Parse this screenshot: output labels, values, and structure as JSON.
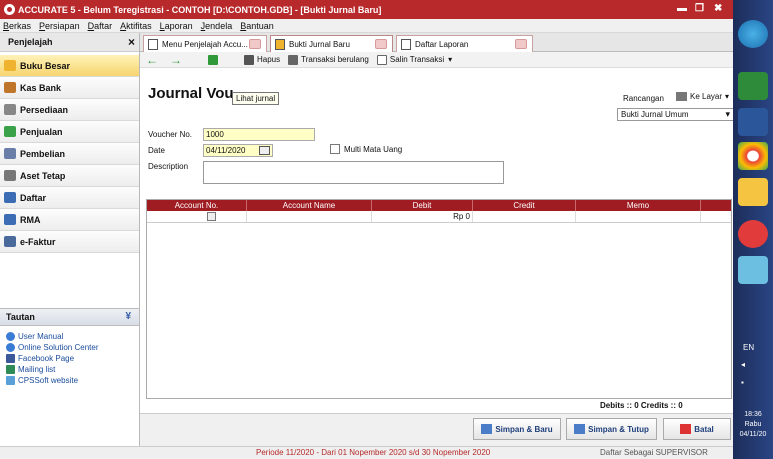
{
  "window": {
    "title": "ACCURATE 5 - Belum Teregistrasi - CONTOH  [D:\\CONTOH.GDB] - [Bukti Jurnal Baru]"
  },
  "menu": [
    "Berkas",
    "Persiapan",
    "Daftar",
    "Aktifitas",
    "Laporan",
    "Jendela",
    "Bantuan"
  ],
  "sidebar": {
    "header": "Penjelajah",
    "items": [
      {
        "label": "Buku Besar",
        "color": "#f0b330"
      },
      {
        "label": "Kas Bank",
        "color": "#c0762a"
      },
      {
        "label": "Persediaan",
        "color": "#888888"
      },
      {
        "label": "Penjualan",
        "color": "#3aa34a"
      },
      {
        "label": "Pembelian",
        "color": "#6a7fa8"
      },
      {
        "label": "Aset Tetap",
        "color": "#777777"
      },
      {
        "label": "Daftar",
        "color": "#3b6cb4"
      },
      {
        "label": "RMA",
        "color": "#3b6cb4"
      },
      {
        "label": "e-Faktur",
        "color": "#4a6a9c"
      }
    ],
    "tautan": "Tautan",
    "links": [
      "User Manual",
      "Online Solution Center",
      "Facebook Page",
      "Mailing list",
      "CPSSoft website"
    ]
  },
  "tabs": [
    "Menu Penjelajah Accu...",
    "Bukti Jurnal Baru",
    "Daftar Laporan"
  ],
  "toolbar": {
    "hapus": "Hapus",
    "berulang": "Transaksi berulang",
    "salin": "Salin Transaksi"
  },
  "form": {
    "title": "Journal Vou",
    "tooltip": "Lihat jurnal",
    "rancangan_label": "Rancangan",
    "ke_layar": "Ke Layar",
    "template": "Bukti Jurnal Umum",
    "voucher_label": "Voucher No.",
    "voucher_value": "1000",
    "date_label": "Date",
    "date_value": "04/11/2020",
    "multi_currency": "Multi Mata Uang",
    "description_label": "Description"
  },
  "grid": {
    "columns": [
      "Account No.",
      "Account Name",
      "Debit",
      "Credit",
      "Memo"
    ],
    "row": {
      "debit": "Rp 0"
    }
  },
  "totals": "Debits :: 0   Credits :: 0",
  "buttons": {
    "save_new": "Simpan & Baru",
    "save_close": "Simpan & Tutup",
    "cancel": "Batal"
  },
  "status": {
    "period": "Periode 11/2020 - Dari 01 Nopember 2020 s/d 30 Nopember 2020",
    "user": "Daftar Sebagai SUPERVISOR"
  },
  "taskbar": {
    "lang": "EN",
    "time": "18:36",
    "day": "Rabu",
    "date": "04/11/20"
  }
}
